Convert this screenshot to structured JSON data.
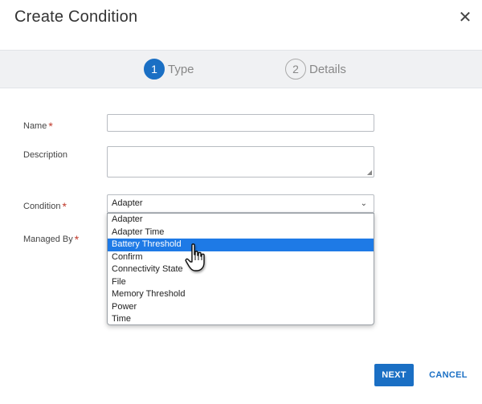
{
  "dialog": {
    "title": "Create Condition",
    "close_symbol": "✕"
  },
  "stepper": {
    "steps": [
      {
        "number": "1",
        "label": "Type",
        "active": true
      },
      {
        "number": "2",
        "label": "Details",
        "active": false
      }
    ]
  },
  "form": {
    "name_label": "Name",
    "description_label": "Description",
    "condition_label": "Condition",
    "managed_by_label": "Managed By",
    "required_marker": "*",
    "condition_value": "Adapter",
    "condition_options": [
      "Adapter",
      "Adapter Time",
      "Battery Threshold",
      "Confirm",
      "Connectivity State",
      "File",
      "Memory Threshold",
      "Power",
      "Time"
    ],
    "highlighted_option": "Battery Threshold"
  },
  "buttons": {
    "next": "NEXT",
    "cancel": "CANCEL"
  },
  "icons": {
    "close": "close-icon",
    "chevron": "chevron-down-icon",
    "cursor": "hand-pointer-icon"
  },
  "colors": {
    "accent": "#1a6fc4",
    "highlight": "#1e7ae6",
    "required": "#c0392b"
  }
}
